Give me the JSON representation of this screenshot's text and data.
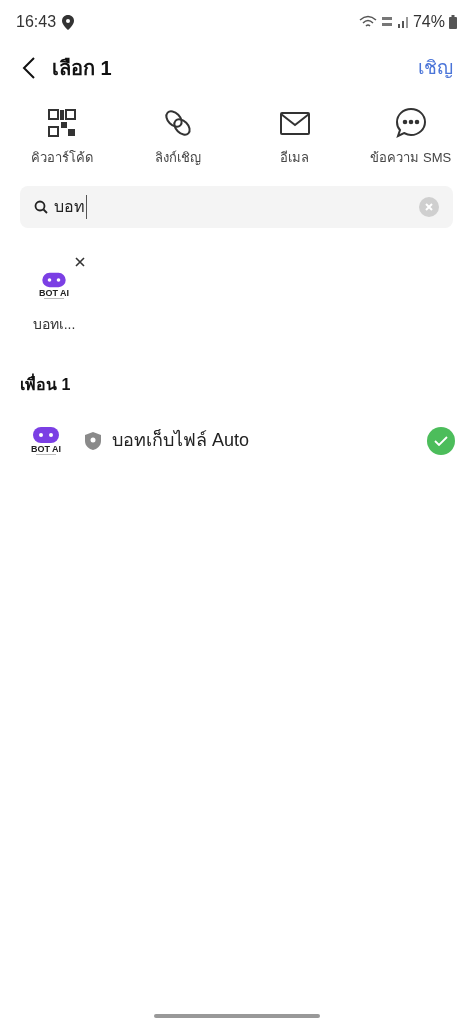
{
  "status_bar": {
    "time": "16:43",
    "battery": "74%"
  },
  "header": {
    "title": "เลือก 1",
    "action": "เชิญ"
  },
  "share_options": [
    {
      "kind": "qr",
      "label": "คิวอาร์โค้ด"
    },
    {
      "kind": "link",
      "label": "ลิงก์เชิญ"
    },
    {
      "kind": "email",
      "label": "อีเมล"
    },
    {
      "kind": "sms",
      "label": "ข้อความ SMS"
    }
  ],
  "search": {
    "value": "บอท"
  },
  "selected_chips": [
    {
      "name": "บอทเ...",
      "logo_text": "BOT AI"
    }
  ],
  "friends": {
    "heading": "เพื่อน 1",
    "items": [
      {
        "name": "บอทเก็บไฟล์ Auto",
        "logo_text": "BOT AI",
        "official": true,
        "selected": true
      }
    ]
  }
}
